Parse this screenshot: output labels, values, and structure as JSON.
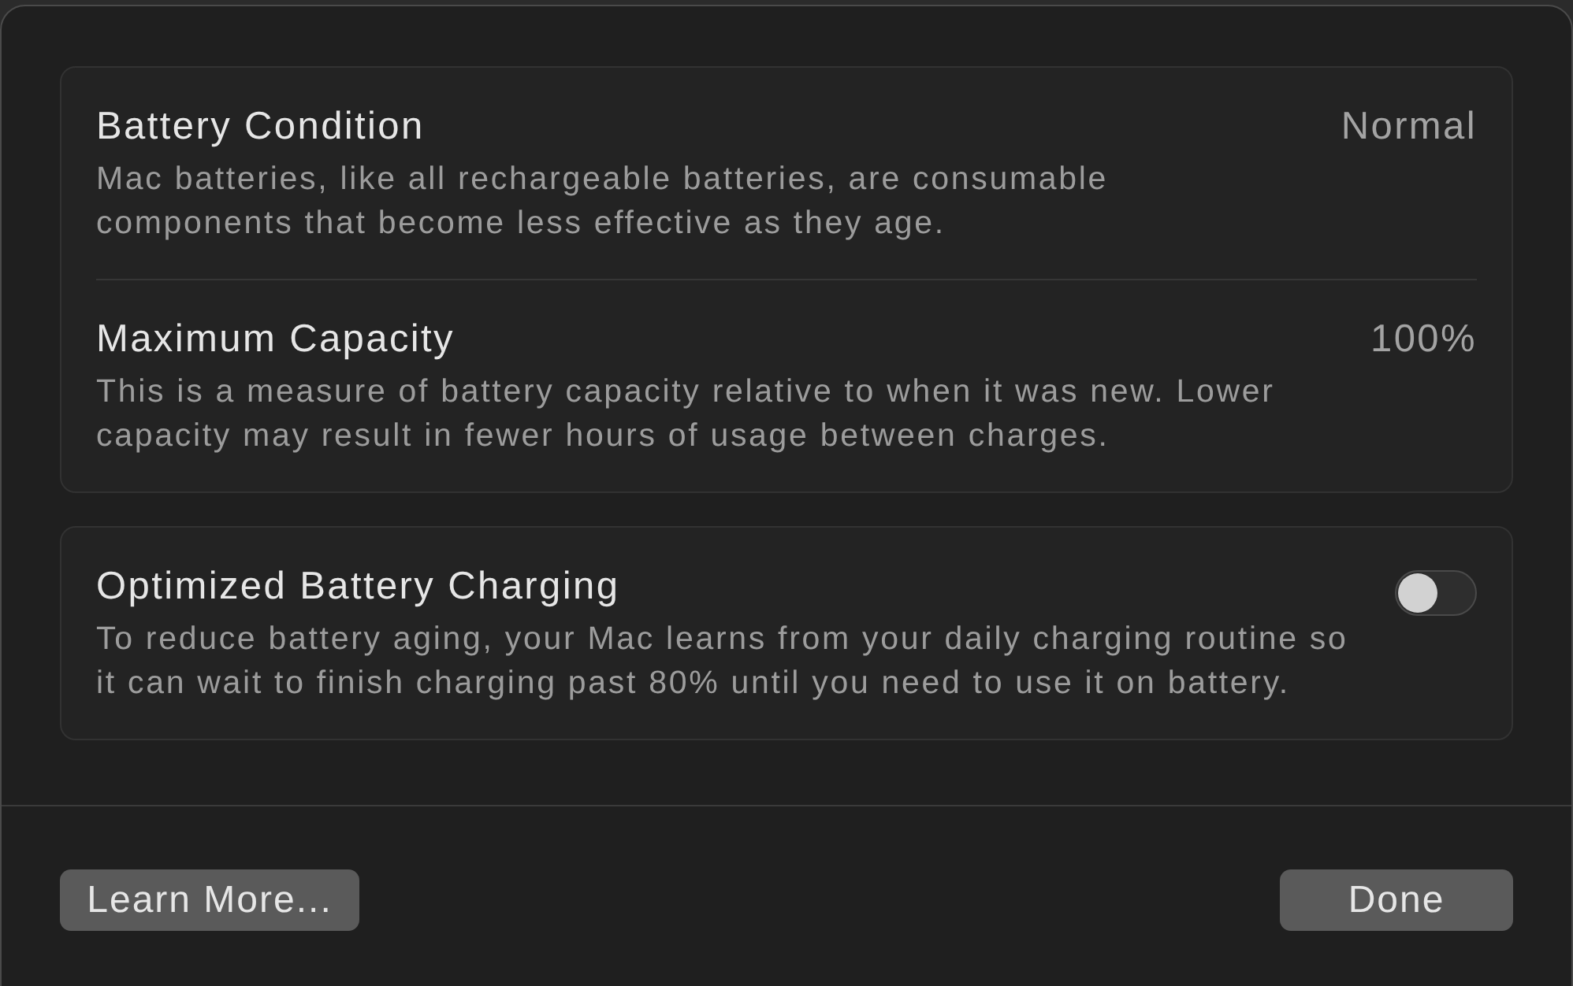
{
  "sections": [
    {
      "rows": [
        {
          "kind": "value",
          "title": "Battery Condition",
          "value": "Normal",
          "description": "Mac batteries, like all rechargeable batteries, are consumable components that become less effective as they age."
        },
        {
          "kind": "value",
          "title": "Maximum Capacity",
          "value": "100%",
          "description": "This is a measure of battery capacity relative to when it was new. Lower capacity may result in fewer hours of usage between charges."
        }
      ]
    },
    {
      "rows": [
        {
          "kind": "toggle",
          "title": "Optimized Battery Charging",
          "on": false,
          "description": "To reduce battery aging, your Mac learns from your daily charging routine so it can wait to finish charging past 80% until you need to use it on battery."
        }
      ]
    }
  ],
  "buttons": [
    {
      "label": "Learn More..."
    },
    {
      "label": "Done"
    }
  ]
}
